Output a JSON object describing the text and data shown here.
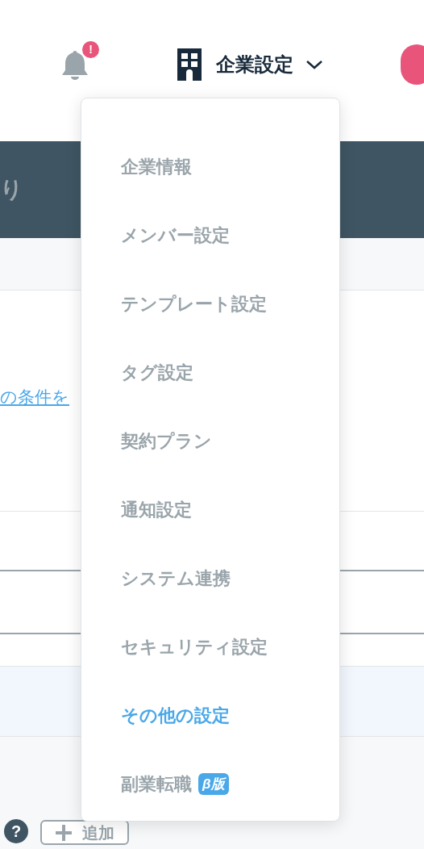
{
  "header": {
    "notification_badge": "!",
    "company_menu": {
      "label": "企業設定",
      "expanded": true
    }
  },
  "banner": {
    "text": "り"
  },
  "content": {
    "link": "の条件を",
    "help_icon": "?",
    "add_button": "追加"
  },
  "dropdown": {
    "items": [
      {
        "label": "企業情報",
        "selected": false
      },
      {
        "label": "メンバー設定",
        "selected": false
      },
      {
        "label": "テンプレート設定",
        "selected": false
      },
      {
        "label": "タグ設定",
        "selected": false
      },
      {
        "label": "契約プラン",
        "selected": false
      },
      {
        "label": "通知設定",
        "selected": false
      },
      {
        "label": "システム連携",
        "selected": false
      },
      {
        "label": "セキュリティ設定",
        "selected": false
      },
      {
        "label": "その他の設定",
        "selected": true
      },
      {
        "label": "副業転職",
        "selected": false,
        "badge": "β版"
      }
    ]
  }
}
